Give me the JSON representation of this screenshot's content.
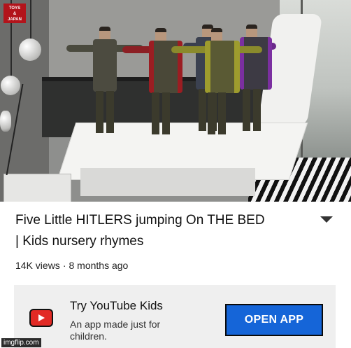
{
  "thumbnail": {
    "channel_logo": [
      "TOYS",
      "&",
      "JAPAN"
    ]
  },
  "video": {
    "title_line1": "Five Little HITLERS jumping On THE BED",
    "title_line2": "| Kids nursery rhymes",
    "views": "14K views",
    "separator": "·",
    "age": "8 months ago",
    "menu_icon": "chevron-down-icon"
  },
  "promo": {
    "title": "Try YouTube Kids",
    "subtitle_line1": "An app made just for",
    "subtitle_line2": "children.",
    "button_label": "OPEN APP",
    "icon": "youtube-kids-icon",
    "button_color": "#1565d8",
    "icon_color": "#e22a25"
  },
  "watermark": "imgflip.com"
}
